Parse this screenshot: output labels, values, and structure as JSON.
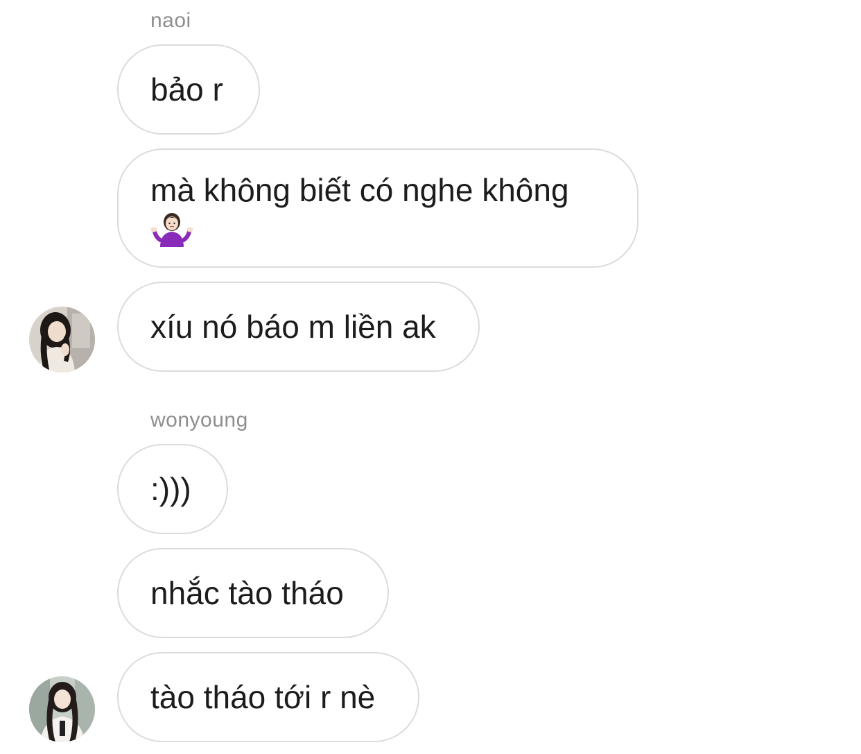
{
  "thread": {
    "groups": [
      {
        "sender": "naoi",
        "messages": [
          {
            "text": "bảo r"
          },
          {
            "line1": "mà không biết có nghe không",
            "emoji": "person-shrugging-emoji"
          },
          {
            "text": "xíu nó báo m liền ak"
          }
        ],
        "avatar_icon": "user-avatar-naoi"
      },
      {
        "sender": "wonyoung",
        "messages": [
          {
            "text": ":)))"
          },
          {
            "text": "nhắc tào tháo"
          },
          {
            "text": "tào tháo tới r nè"
          }
        ],
        "avatar_icon": "user-avatar-wonyoung"
      }
    ]
  },
  "colors": {
    "bubble_border": "#dbdbdb",
    "sender_name": "#8e8e8e",
    "text": "#1c1c1e",
    "background": "#ffffff"
  }
}
